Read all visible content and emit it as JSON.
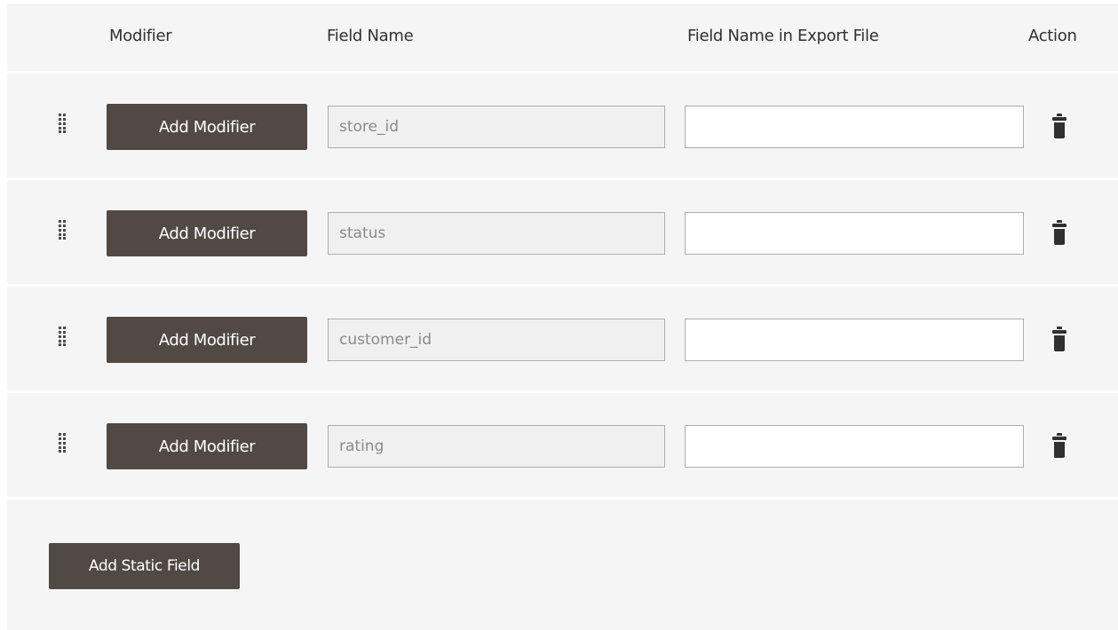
{
  "header": {
    "modifier": "Modifier",
    "field_name": "Field Name",
    "export_name": "Field Name in Export File",
    "action": "Action"
  },
  "rows": [
    {
      "add_modifier_label": "Add Modifier",
      "field_name_value": "store_id",
      "export_name_value": ""
    },
    {
      "add_modifier_label": "Add Modifier",
      "field_name_value": "status",
      "export_name_value": ""
    },
    {
      "add_modifier_label": "Add Modifier",
      "field_name_value": "customer_id",
      "export_name_value": ""
    },
    {
      "add_modifier_label": "Add Modifier",
      "field_name_value": "rating",
      "export_name_value": ""
    }
  ],
  "add_static_field_label": "Add Static Field",
  "icons": {
    "drag": "drag-handle-icon",
    "delete": "trash-icon"
  },
  "colors": {
    "button_bg": "#514943",
    "panel_bg": "#f5f5f5",
    "divider": "#ffffff",
    "input_disabled_bg": "#f0f0f0",
    "input_border": "#adadad"
  }
}
